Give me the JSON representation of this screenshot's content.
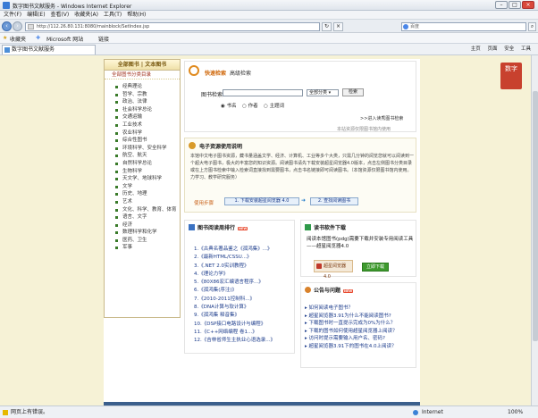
{
  "window": {
    "title": "数字图书文献服务 - Windows Internet Explorer"
  },
  "menu": [
    "文件(F)",
    "编辑(E)",
    "查看(V)",
    "收藏夹(A)",
    "工具(T)",
    "帮助(H)"
  ],
  "address": {
    "url": "http://112.26.80.131:8080/mainblock/SetIndex.jsp"
  },
  "search": {
    "placeholder": "百度"
  },
  "favorites": {
    "label": "收藏夹",
    "items": [
      "Microsoft 网站",
      "链接"
    ]
  },
  "tab": {
    "label": "数字图书文献服务"
  },
  "commands": [
    "主页",
    "页面",
    "安全",
    "工具"
  ],
  "statusbar": {
    "left": "网页上有错误。",
    "zone": "Internet",
    "zoom": "100%"
  },
  "logo": {
    "text": "数字"
  },
  "left_nav": {
    "tabs": [
      "全部图书",
      "文本图书"
    ],
    "subhead": "全部图书分类目录",
    "items": [
      "经典理论",
      "哲学、宗教",
      "政治、法律",
      "社会科学总论",
      "交通运输",
      "工业技术",
      "农业科学",
      "综合性图书",
      "环境科学、安全科学",
      "航空、航天",
      "自然科学总论",
      "生物科学",
      "天文学、地球科学",
      "文学",
      "历史、地理",
      "艺术",
      "文化、科学、教育、体育",
      "语言、文字",
      "经济",
      "数理科学和化学",
      "医药、卫生",
      "军事"
    ]
  },
  "search_panel": {
    "tabs": [
      "快速检索",
      "高级检索"
    ],
    "label": "图书检索",
    "select": "全部分类",
    "button": "检索",
    "radios": [
      "书名",
      "作者",
      "主题词"
    ],
    "link": ">>进入读秀图书检索",
    "footer": "本站资源仅限图书馆内使用"
  },
  "guide": {
    "title": "电子资源使用说明",
    "text": "本馆中文电子图书资源，藏书量涵盖文学、经济、计算机、工业等多个大类，只需几分钟的阅览您就可以阅读到一个超大电子图书，极大的丰富您的知识资源。阅读图书请先下载安装超星阅览器4.0版本，点击左侧图书分类目录或在上方图书检索中输入检索词直接找到需要图书，点击书名链接即可阅读图书。（本馆资源仅限图书馆内使用。力学习、教学研究服务）",
    "steps_label": "使用步骤",
    "step1": "1. 下载安装超星阅览器 4.0",
    "step2": "2. 查找阅读图书"
  },
  "ranking": {
    "title": "图书阅读周排行",
    "badge": "NEW",
    "items": [
      "1.《古典名著品鉴之《孤鸿集》...》",
      "2.《最新HTML/CSSU...》",
      "3.《.NET 2.0实训教程》",
      "4.《理论力学》",
      "5.《80X86宏汇编语言程序...》",
      "6.《孤鸿集(序注)》",
      "7.《2010-2011控制科...》",
      "8.《DNA计算与软计算》",
      "9.《孤鸿集 释音集》",
      "10.《DSP接口电路设计与编程》",
      "11.《C++网络编程 卷1...》",
      "12.《吉林省师生主执业心语选录...》"
    ]
  },
  "download": {
    "title": "读书软件下载",
    "text": "阅读本馆图书(pdg)需要下载并安装专用阅读工具——超星阅览器4.0",
    "product": "超星阅览器 4.0",
    "button": "立即下载"
  },
  "faq": {
    "title": "公告与问题",
    "badge": "NEW",
    "items": [
      "如何阅读电子图书？",
      "超星阅览器3.91为什么不能阅读图书?",
      "下载图书时一直提示完成为0%为什么？",
      "下载的图书如何使用超星阅览器上阅读？",
      "访问时提示需要输入用户名、密码?",
      "超星阅览器3.91下的图书在4.0上阅读？"
    ]
  }
}
